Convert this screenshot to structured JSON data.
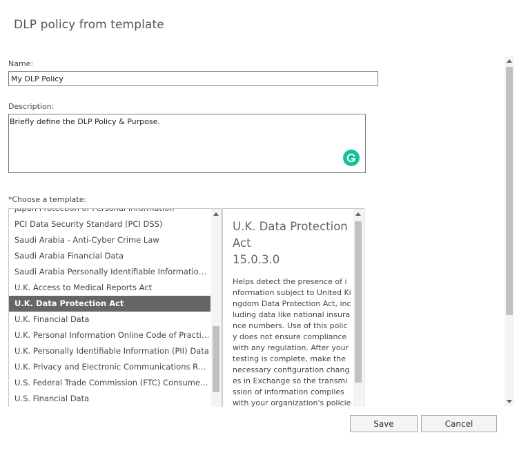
{
  "dialog": {
    "title": "DLP policy from template"
  },
  "name_field": {
    "label": "Name:",
    "value": "My DLP Policy"
  },
  "description_field": {
    "label": "Description:",
    "value": "Briefly define the DLP Policy & Purpose."
  },
  "template_chooser": {
    "label": "*Choose a template:",
    "items": [
      "Japan Protection of Personal Information",
      "PCI Data Security Standard (PCI DSS)",
      "Saudi Arabia - Anti-Cyber Crime Law",
      "Saudi Arabia Financial Data",
      "Saudi Arabia Personally Identifiable Information (P...",
      "U.K. Access to Medical Reports Act",
      "U.K. Data Protection Act",
      "U.K. Financial Data",
      "U.K. Personal Information Online Code of Practice ...",
      "U.K. Personally Identifiable Information (PII) Data",
      "U.K. Privacy and Electronic Communications Regul...",
      "U.S. Federal Trade Commission (FTC) Consumer Ru...",
      "U.S. Financial Data"
    ],
    "selected_index": 6
  },
  "details": {
    "title": "U.K. Data Protection Act",
    "version": "15.0.3.0",
    "description": "Helps detect the presence of information subject to United Kingdom Data Protection Act, including data like national insurance numbers. Use of this policy does not ensure compliance with any regulation. After your testing is complete, make the necessary configuration changes in Exchange so the transmission of information complies with your organization's policies. Example"
  },
  "buttons": {
    "save": "Save",
    "cancel": "Cancel"
  },
  "colors": {
    "selected_bg": "#666666",
    "grammarly": "#15c39a",
    "scroll_thumb": "#c1c1c1"
  },
  "icons": {
    "grammarly": "grammarly-icon",
    "scroll_up": "scroll-up-arrow-icon",
    "scroll_down": "scroll-down-arrow-icon"
  }
}
